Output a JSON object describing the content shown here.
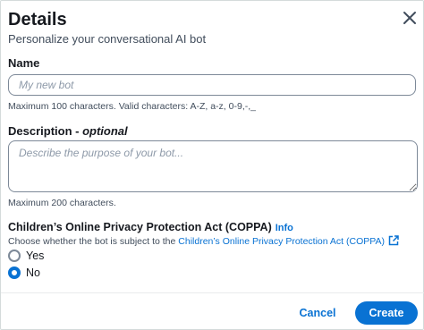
{
  "dialog": {
    "title": "Details",
    "subtitle": "Personalize your conversational AI bot",
    "close_icon": "close-icon"
  },
  "name_field": {
    "label": "Name",
    "placeholder": "My new bot",
    "value": "",
    "hint": "Maximum 100 characters. Valid characters: A-Z, a-z, 0-9,-,_"
  },
  "description_field": {
    "label": "Description - ",
    "label_optional": "optional",
    "placeholder": "Describe the purpose of your bot...",
    "value": "",
    "hint": "Maximum 200 characters."
  },
  "coppa": {
    "title": "Children’s Online Privacy Protection Act (COPPA)",
    "info_link": "Info",
    "description_prefix": "Choose whether the bot is subject to the ",
    "description_link": "Children’s Online Privacy Protection Act (COPPA)",
    "external_icon": "external-link-icon",
    "options": [
      {
        "label": "Yes",
        "selected": false
      },
      {
        "label": "No",
        "selected": true
      }
    ]
  },
  "footer": {
    "cancel_label": "Cancel",
    "create_label": "Create"
  },
  "colors": {
    "accent": "#0972d3",
    "text": "#16191f",
    "muted": "#414d5c",
    "border": "#7d8998"
  }
}
